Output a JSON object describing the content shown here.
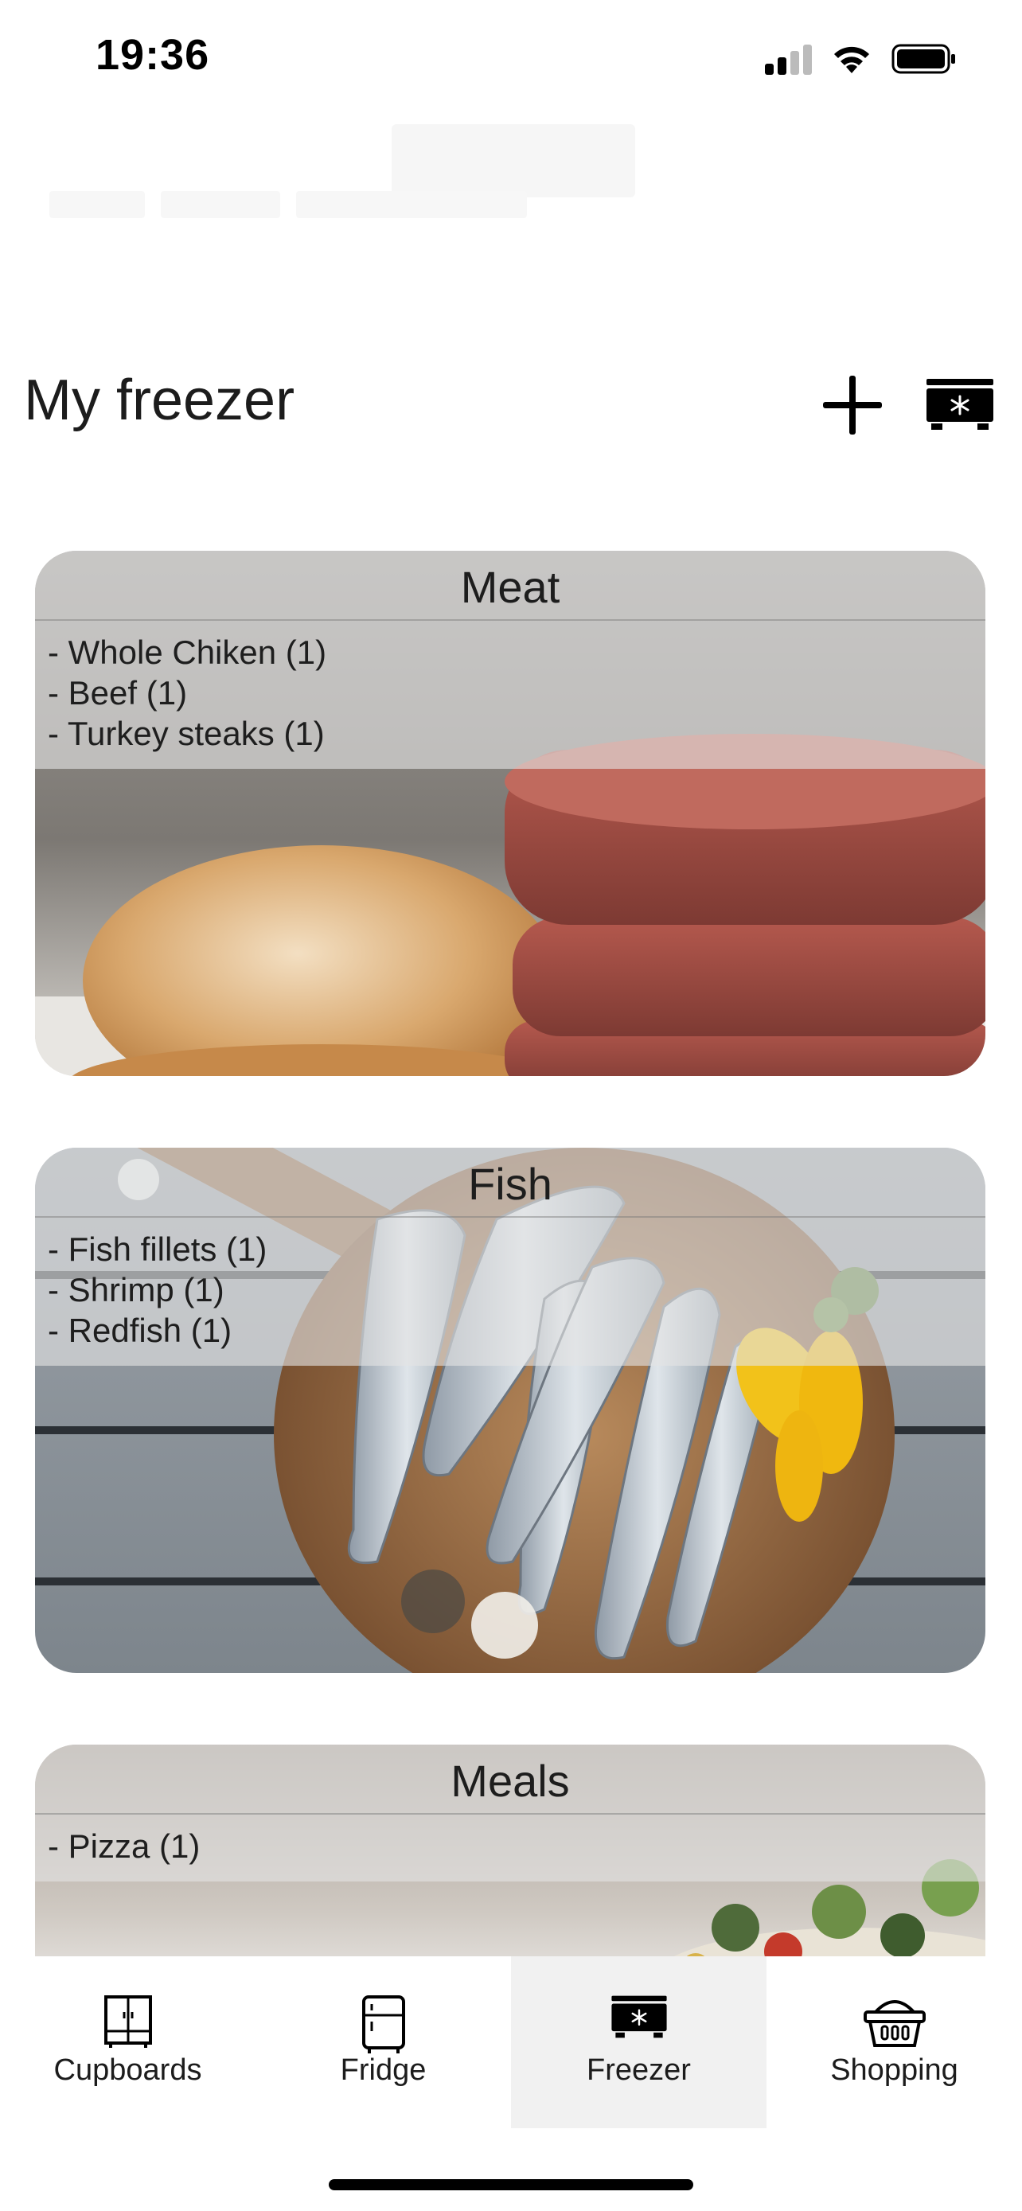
{
  "status_bar": {
    "time": "19:36"
  },
  "header": {
    "title": "My freezer"
  },
  "categories": [
    {
      "title": "Meat",
      "items": [
        "- Whole Chiken (1)",
        "- Beef (1)",
        "- Turkey steaks (1)"
      ]
    },
    {
      "title": "Fish",
      "items": [
        "- Fish fillets (1)",
        "- Shrimp (1)",
        "- Redfish (1)"
      ]
    },
    {
      "title": "Meals",
      "items": [
        "- Pizza (1)"
      ]
    }
  ],
  "tab_bar": {
    "tabs": [
      {
        "label": "Cupboards",
        "icon": "cupboard-icon"
      },
      {
        "label": "Fridge",
        "icon": "fridge-icon"
      },
      {
        "label": "Freezer",
        "icon": "freezer-icon",
        "active": true
      },
      {
        "label": "Shopping",
        "icon": "shopping-basket-icon"
      }
    ]
  }
}
